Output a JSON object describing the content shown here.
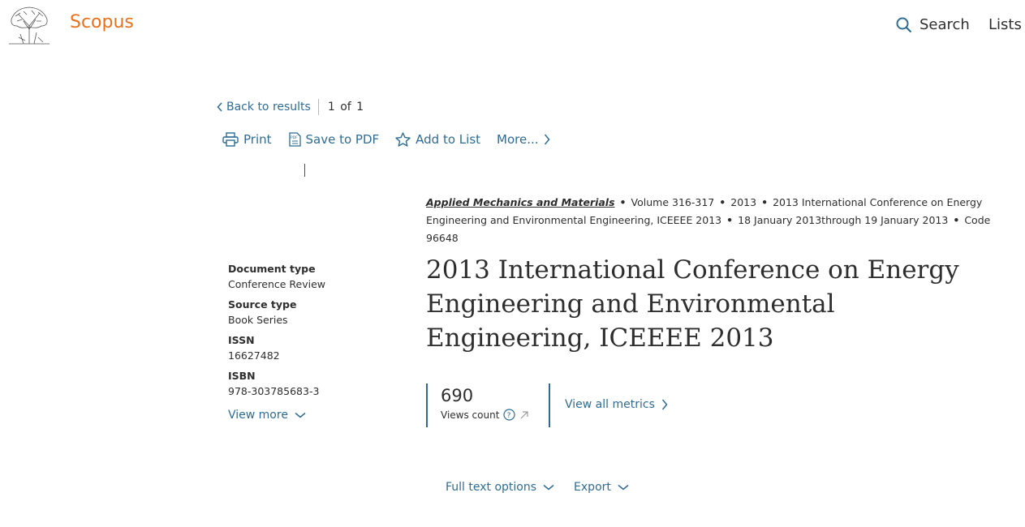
{
  "header": {
    "brand": "Scopus",
    "nav": {
      "search_label": "Search",
      "lists_label": "Lists"
    }
  },
  "navigation": {
    "back_label": "Back to results",
    "pager": "1 of 1"
  },
  "toolbar": {
    "print_label": "Print",
    "save_pdf_label": "Save to PDF",
    "add_list_label": "Add to List",
    "more_label": "More..."
  },
  "source": {
    "journal": "Applied Mechanics and Materials",
    "volume": "Volume 316-317",
    "year": "2013",
    "conference": "2013 International Conference on Energy Engineering and Environmental Engineering, ICEEEE 2013",
    "dates": "18 January 2013through 19 January 2013",
    "code": "Code 96648"
  },
  "document": {
    "title": "2013 International Conference on Energy Engineering and Environmental Engineering, ICEEEE 2013"
  },
  "details": {
    "doc_type_label": "Document type",
    "doc_type_value": "Conference Review",
    "source_type_label": "Source type",
    "source_type_value": "Book Series",
    "issn_label": "ISSN",
    "issn_value": "16627482",
    "isbn_label": "ISBN",
    "isbn_value": "978-303785683-3",
    "view_more_label": "View more"
  },
  "metrics": {
    "views_count": "690",
    "views_label": "Views count",
    "view_all_label": "View all metrics"
  },
  "actions": {
    "full_text_label": "Full text options",
    "export_label": "Export"
  },
  "colors": {
    "brand": "#e9711c",
    "link": "#2e6c94",
    "text": "#2e2e2e"
  }
}
